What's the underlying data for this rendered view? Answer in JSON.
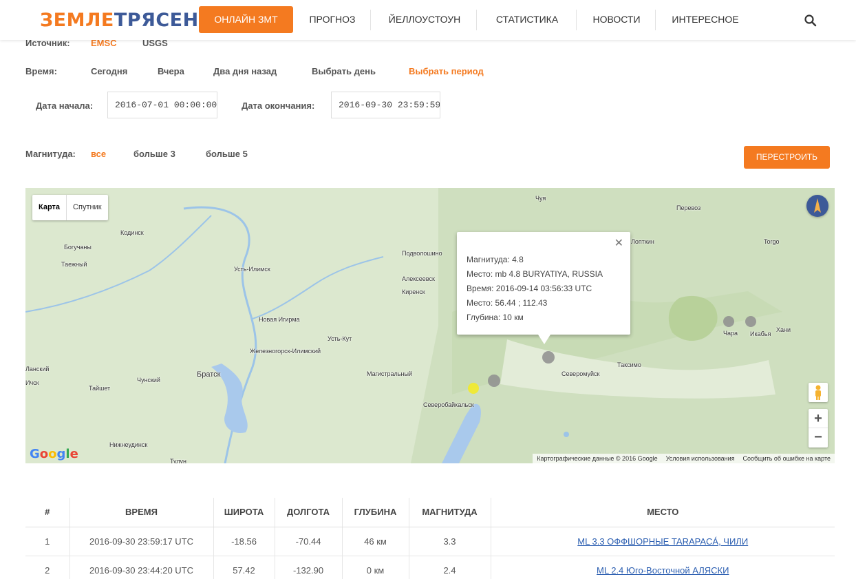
{
  "logo": {
    "part1": "ЗЕМЛЕ",
    "part2": "ТРЯСЕНИЯ"
  },
  "nav": {
    "active": "ОНЛАЙН ЗМТ",
    "items": [
      "ПРОГНОЗ",
      "ЙЕЛЛОУСТОУН",
      "СТАТИСТИКА",
      "НОВОСТИ",
      "ИНТЕРЕСНОЕ"
    ]
  },
  "filters": {
    "source_label": "Источник:",
    "sources": [
      "EMSC",
      "USGS"
    ],
    "active_source": "EMSC",
    "time_label": "Время:",
    "time_options": [
      "Сегодня",
      "Вчера",
      "Два дня назад",
      "Выбрать день",
      "Выбрать период"
    ],
    "active_time": "Выбрать период",
    "start_label": "Дата начала:",
    "start_value": "2016-07-01 00:00:00",
    "end_label": "Дата окончания:",
    "end_value": "2016-09-30 23:59:59",
    "magnitude_label": "Магнитуда:",
    "magnitude_options": [
      "все",
      "больше 3",
      "больше 5"
    ],
    "active_magnitude": "все",
    "rebuild_label": "ПЕРЕСТРОИТЬ"
  },
  "map": {
    "type_buttons": [
      "Карта",
      "Спутник"
    ],
    "active_type": "Карта",
    "towns": [
      "Чуя",
      "Перевоз",
      "Кодинск",
      "Подволошино",
      "Богучаны",
      "Таежный",
      "Усть-Илимск",
      "Алексеевск",
      "Киренск",
      "Новая Игирма",
      "Усть-Кут",
      "Железногорск-Илимский",
      "Магистральный",
      "Братск",
      "Чунский",
      "Тайшет",
      "Нижнеудинск",
      "Тулун",
      "Северобайкальск",
      "Северомуйск",
      "Таксимо",
      "Чара",
      "Икабья",
      "Хани",
      "Torgo",
      "Лопткин",
      "Ланский",
      "Ичск"
    ],
    "popup": {
      "magnitude": "Магнитуда: 4.8",
      "place": "Место: mb 4.8 BURYATIYA, RUSSIA",
      "time": "Время: 2016-09-14 03:56:33 UTC",
      "coords": "Место: 56.44 ; 112.43",
      "depth": "Глубина: 10 км"
    },
    "zoom_in": "+",
    "zoom_out": "−",
    "google": "Google",
    "attribution": [
      "Картографические данные © 2016 Google",
      "Условия использования",
      "Сообщить об ошибке на карте"
    ]
  },
  "table": {
    "headers": [
      "#",
      "ВРЕМЯ",
      "ШИРОТА",
      "ДОЛГОТА",
      "ГЛУБИНА",
      "МАГНИТУДА",
      "МЕСТО"
    ],
    "rows": [
      {
        "n": "1",
        "time": "2016-09-30 23:59:17 UTC",
        "lat": "-18.56",
        "lon": "-70.44",
        "depth": "46 км",
        "mag": "3.3",
        "place": "ML 3.3 ОФФШОРНЫЕ TARAPACÁ, ЧИЛИ"
      },
      {
        "n": "2",
        "time": "2016-09-30 23:44:20 UTC",
        "lat": "57.42",
        "lon": "-132.90",
        "depth": "0 км",
        "mag": "2.4",
        "place": "ML 2.4 Юго-Восточной АЛЯСКИ"
      }
    ]
  }
}
